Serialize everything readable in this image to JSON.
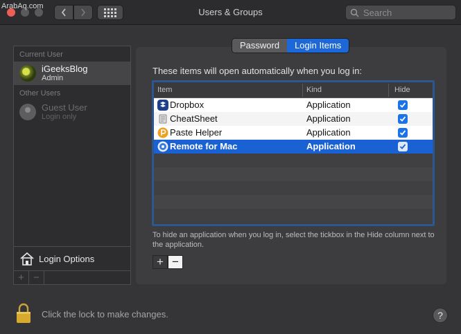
{
  "watermark": "ArabAq.com",
  "window": {
    "title": "Users & Groups"
  },
  "search": {
    "placeholder": "Search"
  },
  "sidebar": {
    "current_user_label": "Current User",
    "current_user": {
      "name": "iGeeksBlog",
      "role": "Admin"
    },
    "other_users_label": "Other Users",
    "other_users": [
      {
        "name": "Guest User",
        "role": "Login only"
      }
    ],
    "login_options_label": "Login Options",
    "add_label": "+",
    "remove_label": "−"
  },
  "tabs": [
    {
      "label": "Password",
      "active": false
    },
    {
      "label": "Login Items",
      "active": true
    }
  ],
  "login_items": {
    "intro": "These items will open automatically when you log in:",
    "columns": {
      "item": "Item",
      "kind": "Kind",
      "hide": "Hide"
    },
    "rows": [
      {
        "name": "Dropbox",
        "kind": "Application",
        "hide": true,
        "icon": "dropbox-icon"
      },
      {
        "name": "CheatSheet",
        "kind": "Application",
        "hide": true,
        "icon": "cheatsheet-icon"
      },
      {
        "name": "Paste Helper",
        "kind": "Application",
        "hide": true,
        "icon": "paste-helper-icon"
      },
      {
        "name": "Remote for Mac",
        "kind": "Application",
        "hide": true,
        "icon": "remote-for-mac-icon",
        "selected": true
      }
    ],
    "hint": "To hide an application when you log in, select the tickbox in the Hide column next to the application.",
    "add_label": "+",
    "remove_label": "−"
  },
  "footer": {
    "lock_text": "Click the lock to make changes.",
    "help_label": "?"
  },
  "colors": {
    "accent": "#1a61d3",
    "close": "#ec5f57"
  }
}
